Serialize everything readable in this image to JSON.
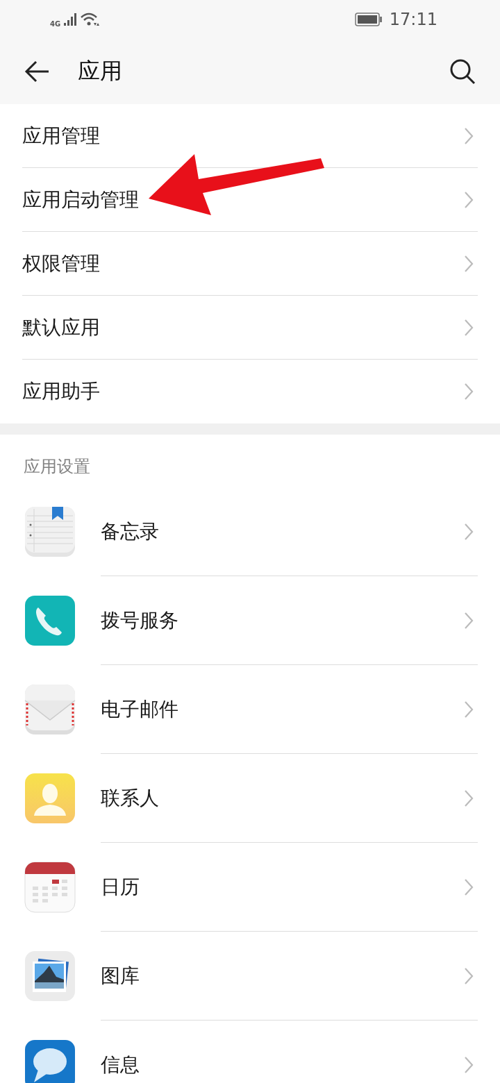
{
  "status_bar": {
    "network": "4G",
    "time": "17:11"
  },
  "header": {
    "title": "应用"
  },
  "menu": [
    {
      "label": "应用管理"
    },
    {
      "label": "应用启动管理"
    },
    {
      "label": "权限管理"
    },
    {
      "label": "默认应用"
    },
    {
      "label": "应用助手"
    }
  ],
  "section": {
    "title": "应用设置",
    "apps": [
      {
        "label": "备忘录",
        "kind": "notes"
      },
      {
        "label": "拨号服务",
        "kind": "phone"
      },
      {
        "label": "电子邮件",
        "kind": "mail"
      },
      {
        "label": "联系人",
        "kind": "contact"
      },
      {
        "label": "日历",
        "kind": "calendar"
      },
      {
        "label": "图库",
        "kind": "gallery"
      },
      {
        "label": "信息",
        "kind": "message"
      }
    ]
  }
}
